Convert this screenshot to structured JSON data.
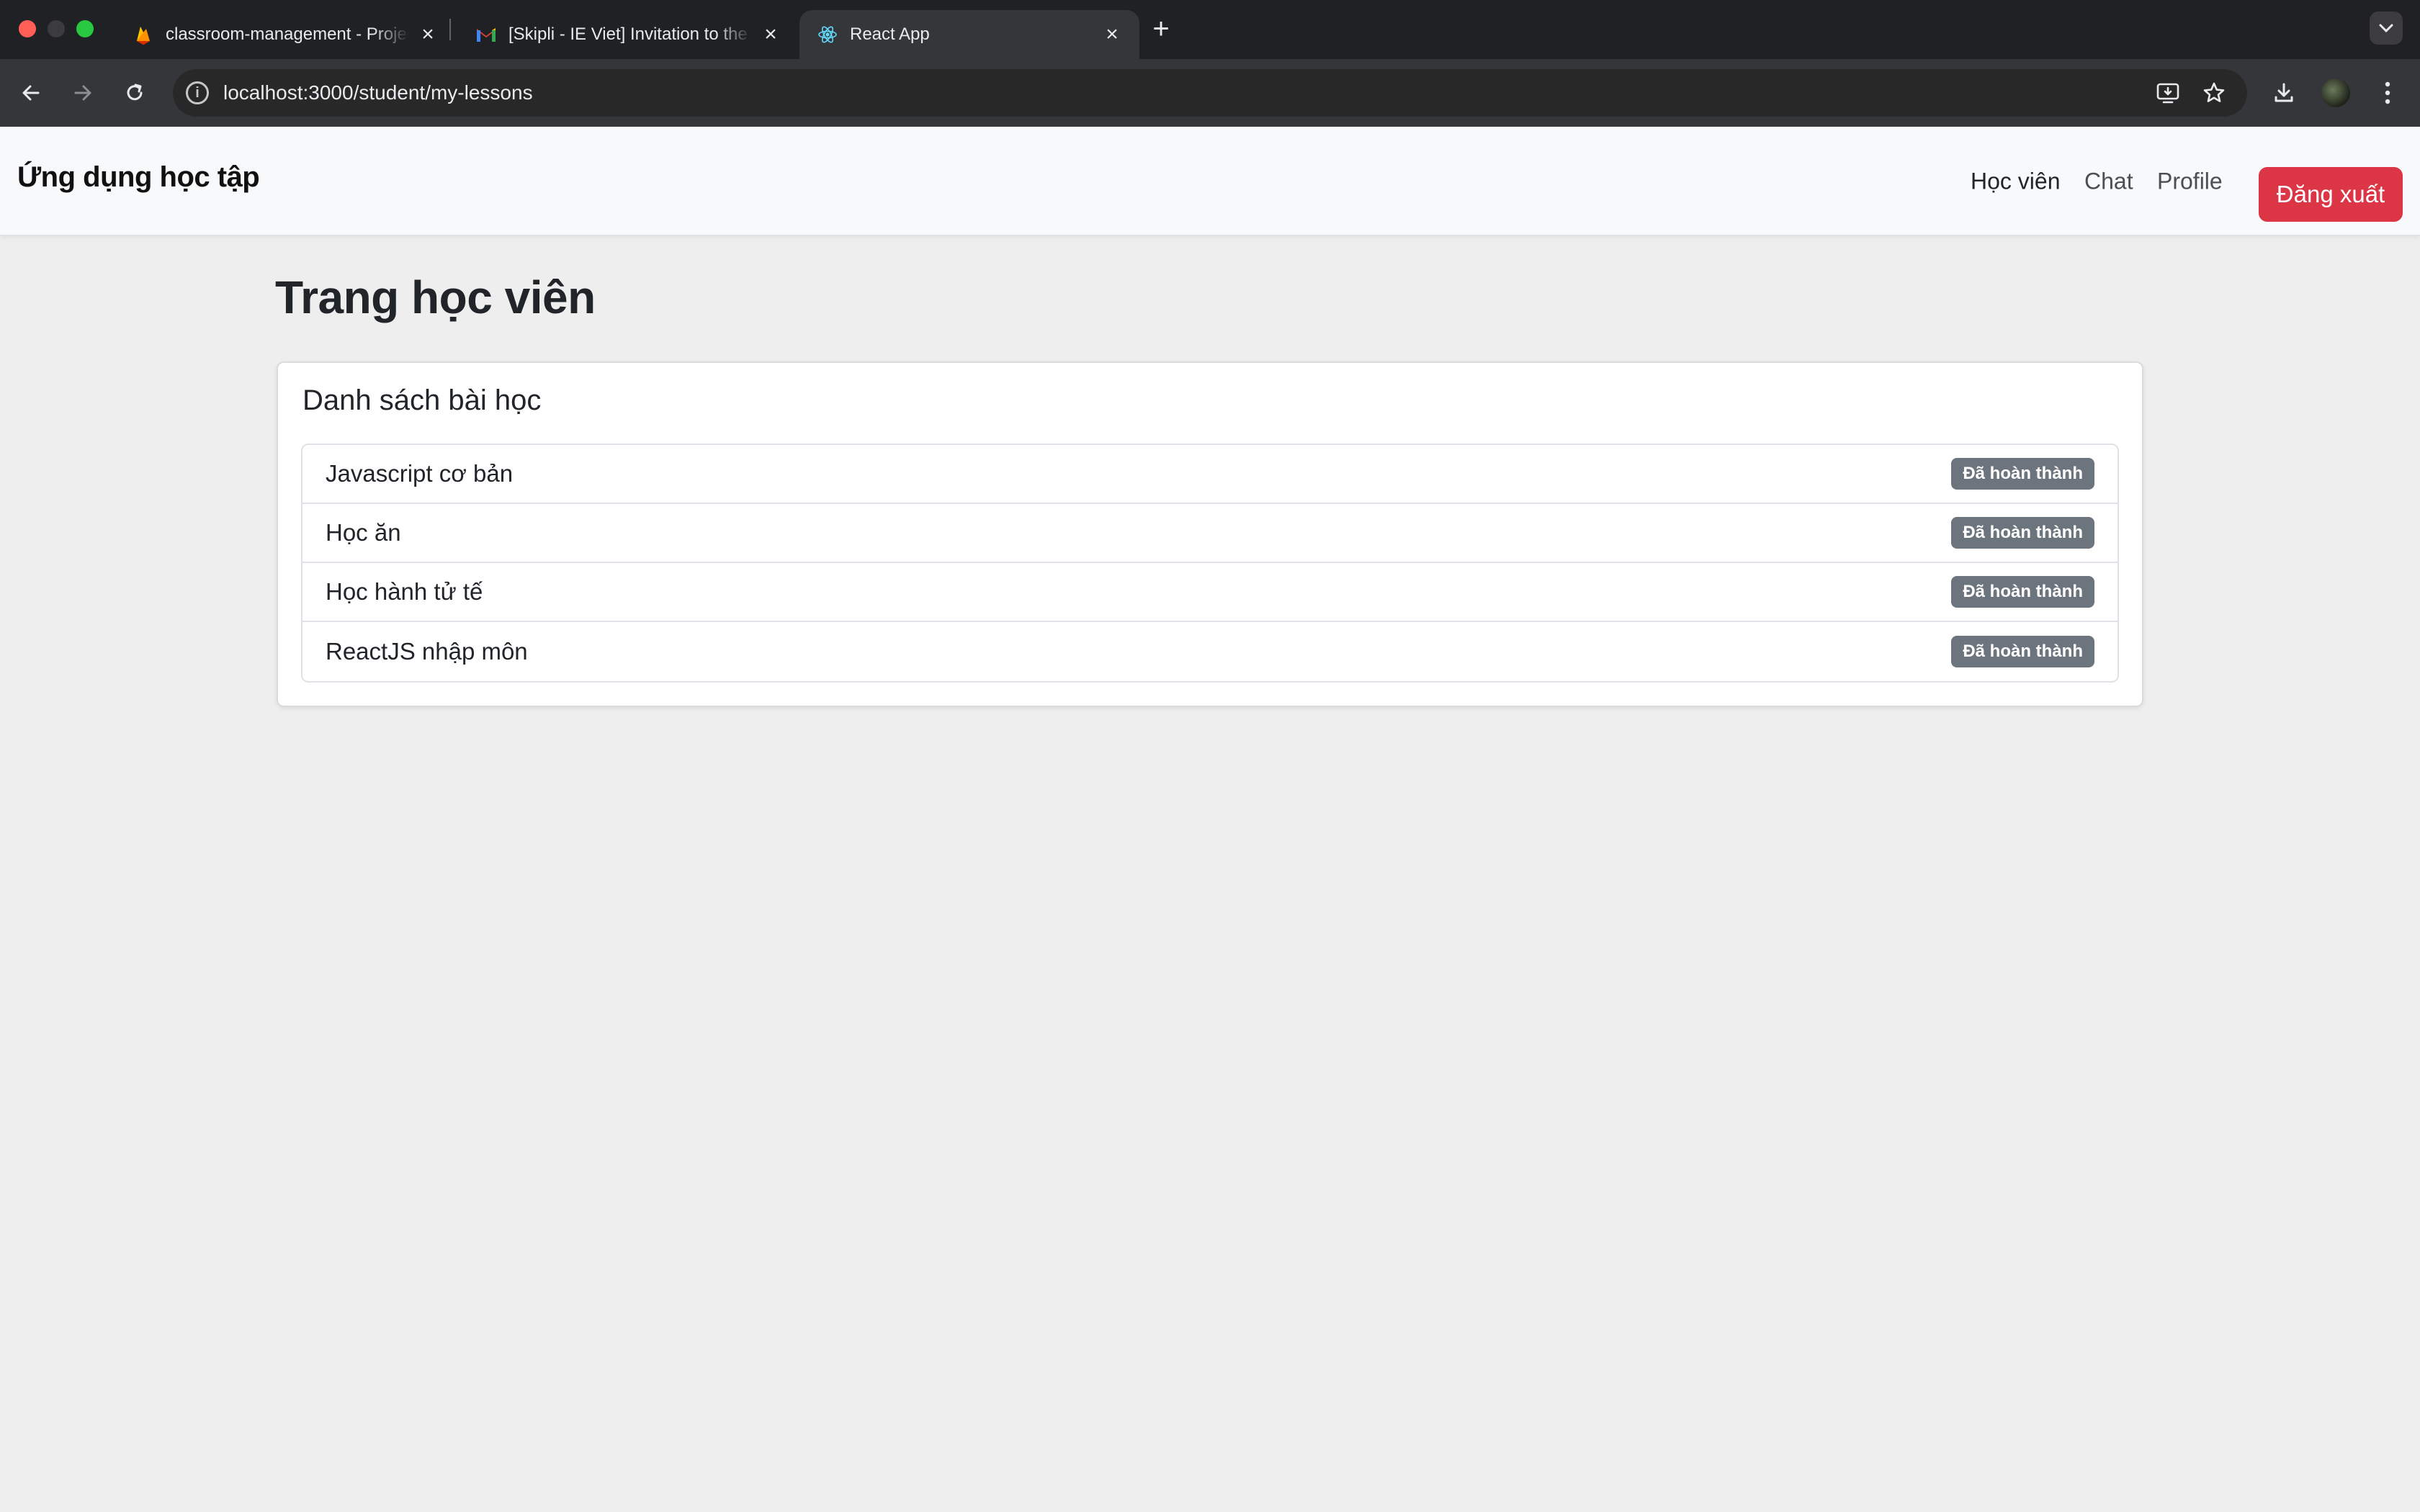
{
  "browser": {
    "tabs": [
      {
        "title": "classroom-management - Project",
        "icon": "firebase-flame-icon",
        "active": false
      },
      {
        "title": "[Skipli - IE Viet] Invitation to the",
        "icon": "gmail-icon",
        "active": false
      },
      {
        "title": "React App",
        "icon": "react-icon",
        "active": true
      }
    ],
    "url": "localhost:3000/student/my-lessons"
  },
  "navbar": {
    "brand": "Ứng dụng học tập",
    "links": [
      "Học viên",
      "Chat",
      "Profile"
    ],
    "logout_label": "Đăng xuất",
    "logout_color": "#dc3545"
  },
  "page": {
    "title": "Trang học viên"
  },
  "lessons_card": {
    "title": "Danh sách bài học",
    "items": [
      {
        "name": "Javascript cơ bản",
        "status": "Đã hoàn thành"
      },
      {
        "name": "Học ăn",
        "status": "Đã hoàn thành"
      },
      {
        "name": "Học hành tử tế",
        "status": "Đã hoàn thành"
      },
      {
        "name": "ReactJS nhập môn",
        "status": "Đã hoàn thành"
      }
    ],
    "badge_color": "#6c757d"
  }
}
